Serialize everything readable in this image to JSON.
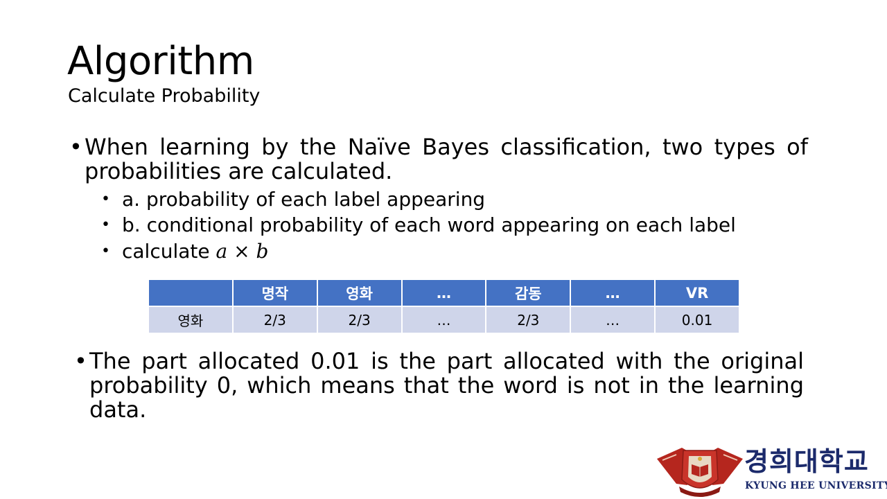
{
  "slide": {
    "title": "Algorithm",
    "subtitle": "Calculate Probability",
    "bullet_1": "When learning by the Naïve Bayes classification, two types of probabilities are calculated.",
    "sub_bullets": [
      "a. probability of each label appearing",
      "b. conditional probability of each word appearing on each label"
    ],
    "calc_prefix": "calculate",
    "calc_a": "a",
    "calc_op": "×",
    "calc_b": "b",
    "bullet_2": "The part allocated 0.01 is the part allocated with the original probability 0, which means that the word is not in the learning data.",
    "bullet_glyph": "•"
  },
  "table": {
    "headers": [
      "",
      "명작",
      "영화",
      "…",
      "감동",
      "…",
      "VR"
    ],
    "rows": [
      [
        "영화",
        "2/3",
        "2/3",
        "…",
        "2/3",
        "…",
        "0.01"
      ]
    ]
  },
  "logo": {
    "korean_name": "경희대학교",
    "english_name": "KYUNG HEE UNIVERSITY"
  },
  "colors": {
    "header_bg": "#4472c4",
    "row_bg": "#cfd5ea",
    "logo_red": "#b5261e",
    "logo_navy": "#1b2a6b"
  }
}
